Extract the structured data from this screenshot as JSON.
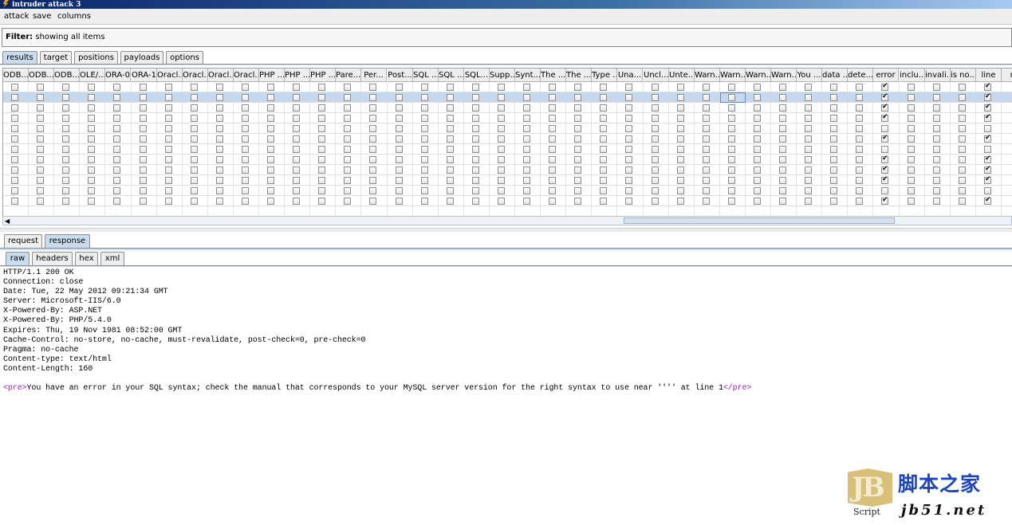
{
  "window": {
    "title": "intruder attack 3"
  },
  "menu": [
    "attack",
    "save",
    "columns"
  ],
  "filter": {
    "label": "Filter:",
    "text": "showing all items"
  },
  "main_tabs": [
    {
      "label": "results",
      "active": true
    },
    {
      "label": "target",
      "active": false
    },
    {
      "label": "positions",
      "active": false
    },
    {
      "label": "payloads",
      "active": false
    },
    {
      "label": "options",
      "active": false
    }
  ],
  "columns": [
    "ODB...",
    "ODB...",
    "ODB...",
    "OLE/...",
    "ORA-0",
    "ORA-1",
    "Oracl...",
    "Oracl...",
    "Oracl...",
    "Oracl...",
    "PHP ...",
    "PHP ...",
    "PHP ...",
    "Pare...",
    "Per...",
    "Post...",
    "SQL ...",
    "SQL ...",
    "SQL...",
    "Supp...",
    "Synt...",
    "The ...",
    "The ...",
    "Type ...",
    "Una...",
    "Uncl...",
    "Unte...",
    "Warn...",
    "Warn...",
    "Warn...",
    "Warn...",
    "You ...",
    "data ...",
    "dete...",
    "error",
    "inclu...",
    "invali...",
    "is no...",
    "line",
    "m"
  ],
  "rows": [
    {
      "checked": [
        34,
        38
      ],
      "selected": false
    },
    {
      "checked": [
        34,
        38
      ],
      "selected": true
    },
    {
      "checked": [
        34,
        38
      ],
      "selected": false
    },
    {
      "checked": [
        34,
        38
      ],
      "selected": false
    },
    {
      "checked": [],
      "selected": false
    },
    {
      "checked": [
        34,
        38
      ],
      "selected": false
    },
    {
      "checked": [],
      "selected": false
    },
    {
      "checked": [
        34,
        38
      ],
      "selected": false
    },
    {
      "checked": [
        34,
        38
      ],
      "selected": false
    },
    {
      "checked": [
        34,
        38
      ],
      "selected": false
    },
    {
      "checked": [],
      "selected": false
    },
    {
      "checked": [
        34,
        38
      ],
      "selected": false
    }
  ],
  "focused_cell": {
    "row": 1,
    "col": 28
  },
  "detail_tabs": [
    {
      "label": "request",
      "active": false
    },
    {
      "label": "response",
      "active": true
    }
  ],
  "view_tabs": [
    {
      "label": "raw",
      "active": true
    },
    {
      "label": "headers",
      "active": false
    },
    {
      "label": "hex",
      "active": false
    },
    {
      "label": "xml",
      "active": false
    }
  ],
  "response": {
    "headers": [
      "HTTP/1.1 200 OK",
      "Connection: close",
      "Date: Tue, 22 May 2012 09:21:34 GMT",
      "Server: Microsoft-IIS/6.0",
      "X-Powered-By: ASP.NET",
      "X-Powered-By: PHP/5.4.0",
      "Expires: Thu, 19 Nov 1981 08:52:00 GMT",
      "Cache-Control: no-store, no-cache, must-revalidate, post-check=0, pre-check=0",
      "Pragma: no-cache",
      "Content-type: text/html",
      "Content-Length: 160"
    ],
    "body_open_tag": "<pre>",
    "body_text": "You have an error in your SQL syntax; check the manual that corresponds to your MySQL server version for the right syntax to use near '''' at line 1",
    "body_close_tag": "</pre>"
  },
  "watermark": {
    "logo": "JB",
    "sub": "Script",
    "cn": "脚本之家",
    "site": "jb51.net"
  }
}
